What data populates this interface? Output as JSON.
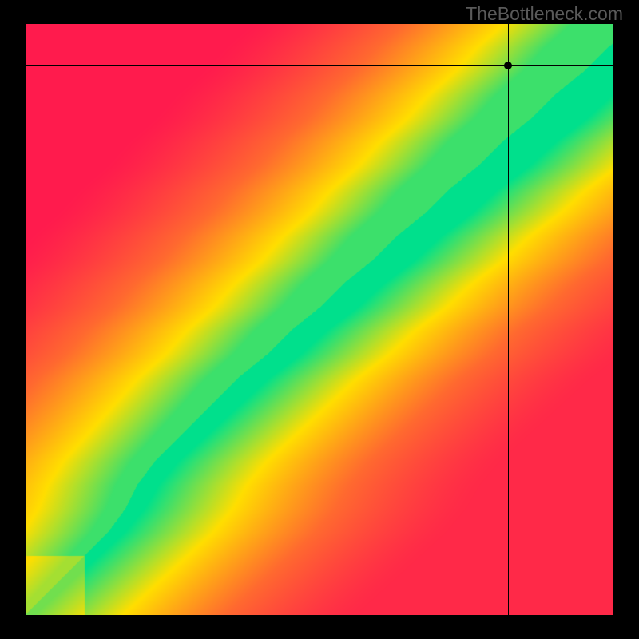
{
  "watermark": "TheBottleneck.com",
  "chart_data": {
    "type": "heatmap",
    "title": "",
    "xlabel": "",
    "ylabel": "",
    "xlim": [
      0,
      100
    ],
    "ylim": [
      0,
      100
    ],
    "ridge": [
      [
        0,
        0
      ],
      [
        2,
        2
      ],
      [
        4,
        4
      ],
      [
        6,
        6
      ],
      [
        8,
        8
      ],
      [
        10,
        10
      ],
      [
        12,
        12
      ],
      [
        14,
        14
      ],
      [
        16,
        15.5
      ],
      [
        18,
        17
      ],
      [
        20,
        18
      ],
      [
        22,
        19
      ],
      [
        24,
        20.5
      ],
      [
        26,
        22
      ],
      [
        28,
        24
      ],
      [
        30,
        26
      ],
      [
        33,
        29
      ],
      [
        36,
        32
      ],
      [
        40,
        36
      ],
      [
        44,
        41
      ],
      [
        48,
        45
      ],
      [
        52,
        50
      ],
      [
        56,
        54
      ],
      [
        60,
        59
      ],
      [
        64,
        63
      ],
      [
        68,
        68
      ],
      [
        72,
        72
      ],
      [
        76,
        77
      ],
      [
        80,
        81
      ],
      [
        84,
        86
      ],
      [
        88,
        90
      ],
      [
        92,
        95
      ],
      [
        96,
        99
      ],
      [
        100,
        104
      ]
    ],
    "ridge_width_base": 1.5,
    "ridge_width_top": 11.0,
    "marker": {
      "x": 82,
      "y": 93
    },
    "colors": {
      "worst": "#ff1b4d",
      "low": "#ff6a2f",
      "mid": "#ffde00",
      "best": "#00e08c"
    }
  }
}
